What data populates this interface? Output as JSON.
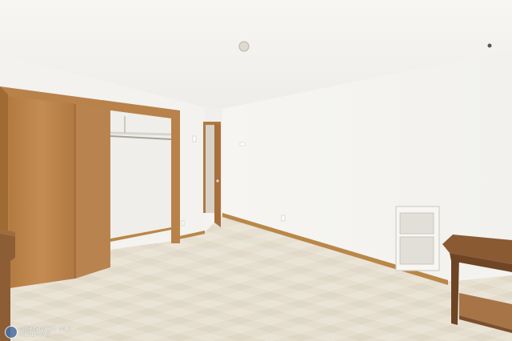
{
  "photo": {
    "subject": "empty bedroom",
    "watermark": {
      "line1": "NORTHWEST MLS",
      "line2": "REALTORS"
    }
  },
  "colors": {
    "wall": "#f4f3ef",
    "ceiling": "#f6f5f2",
    "wood": "#b8824a",
    "floor": "#e3dccd",
    "baseboard": "#b98748"
  }
}
